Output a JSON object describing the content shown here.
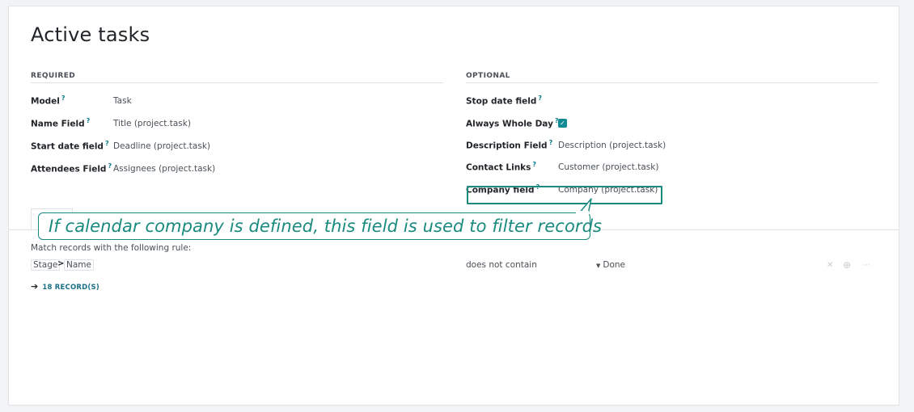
{
  "page": {
    "title": "Active tasks"
  },
  "required": {
    "heading": "REQUIRED",
    "fields": [
      {
        "label": "Model",
        "help": "?",
        "value": "Task"
      },
      {
        "label": "Name Field",
        "help": "?",
        "value": "Title (project.task)"
      },
      {
        "label": "Start date field",
        "help": "?",
        "value": "Deadline (project.task)"
      },
      {
        "label": "Attendees Field",
        "help": "?",
        "value": "Assignees (project.task)"
      }
    ]
  },
  "optional": {
    "heading": "OPTIONAL",
    "fields": [
      {
        "label": "Stop date field",
        "help": "?",
        "value": ""
      },
      {
        "label": "Always Whole Day",
        "help": "?",
        "checked": true
      },
      {
        "label": "Description Field",
        "help": "?",
        "value": "Description (project.task)"
      },
      {
        "label": "Contact Links",
        "help": "?",
        "value": "Customer (project.task)"
      },
      {
        "label": "Company field",
        "help": "?",
        "value": "Company (project.task)"
      }
    ]
  },
  "callout": {
    "text": "If calendar company is defined, this field is used to filter records"
  },
  "domain": {
    "intro": "Match records with the following rule:",
    "path": [
      "Stage",
      "Name"
    ],
    "path_separator": ">",
    "operator": "does not contain",
    "value": "Done",
    "records": "18 RECORD(S)",
    "icons": [
      "close-icon",
      "add-icon",
      "more-icon"
    ]
  },
  "colors": {
    "accent": "#1a8a7e",
    "link": "#1b6f86",
    "checkbox": "#0e8a94"
  }
}
